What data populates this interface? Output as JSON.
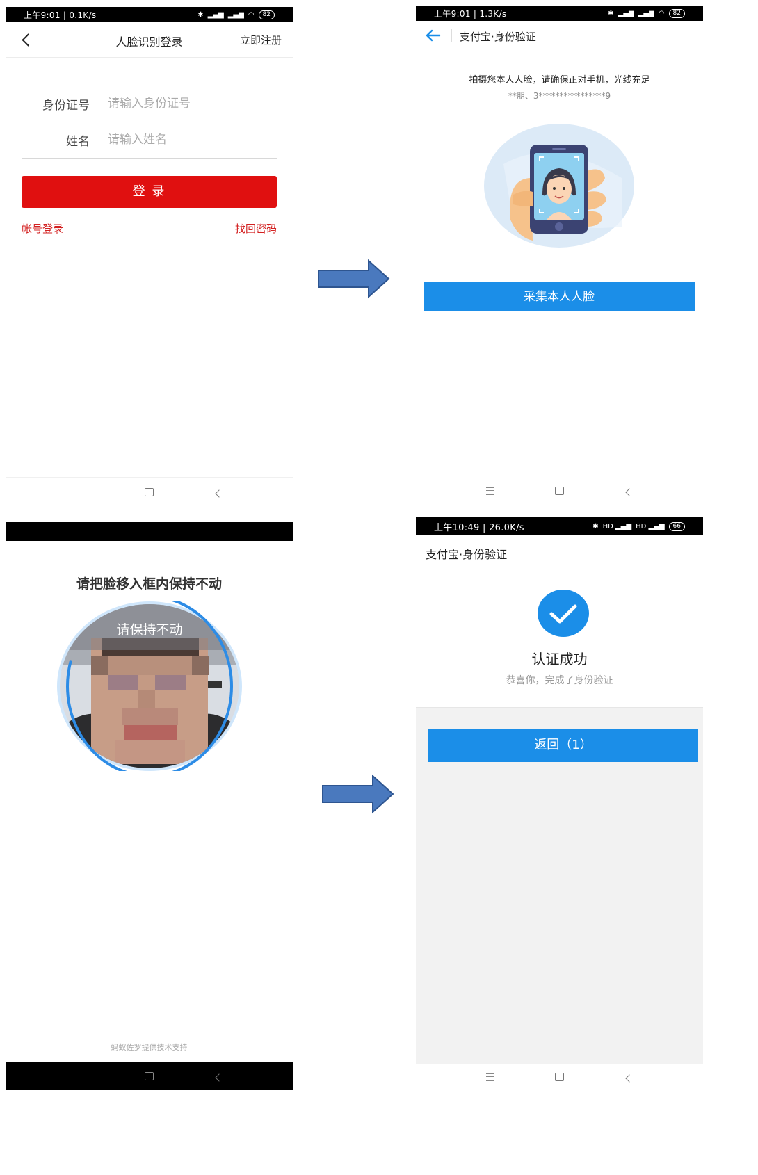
{
  "panel1": {
    "status_left": "上午9:01 | 0.1K/s",
    "status_battery": "82",
    "title": "人脸识别登录",
    "register_link": "立即注册",
    "id_label": "身份证号",
    "id_placeholder": "请输入身份证号",
    "name_label": "姓名",
    "name_placeholder": "请输入姓名",
    "login_button": "登 录",
    "account_login_link": "帐号登录",
    "recover_password_link": "找回密码"
  },
  "panel2": {
    "status_left": "上午9:01 | 1.3K/s",
    "status_battery": "82",
    "title": "支付宝·身份验证",
    "instruction": "拍摄您本人人脸，请确保正对手机，光线充足",
    "masked_identity": "**朋、3****************9",
    "capture_button": "采集本人人脸"
  },
  "panel3": {
    "instruction": "请把脸移入框内保持不动",
    "camera_overlay": "请保持不动",
    "footer": "蚂蚁佐罗提供技术支持"
  },
  "panel4": {
    "status_left": "上午10:49 | 26.0K/s",
    "status_battery": "66",
    "title": "支付宝·身份验证",
    "success_title": "认证成功",
    "success_subtitle": "恭喜你，完成了身份验证",
    "return_button": "返回（1）"
  },
  "colors": {
    "red_primary": "#e01010",
    "red_link": "#d32020",
    "alipay_blue": "#1b8ee8",
    "arrow_fill": "#4a79be",
    "arrow_stroke": "#2e5590"
  }
}
